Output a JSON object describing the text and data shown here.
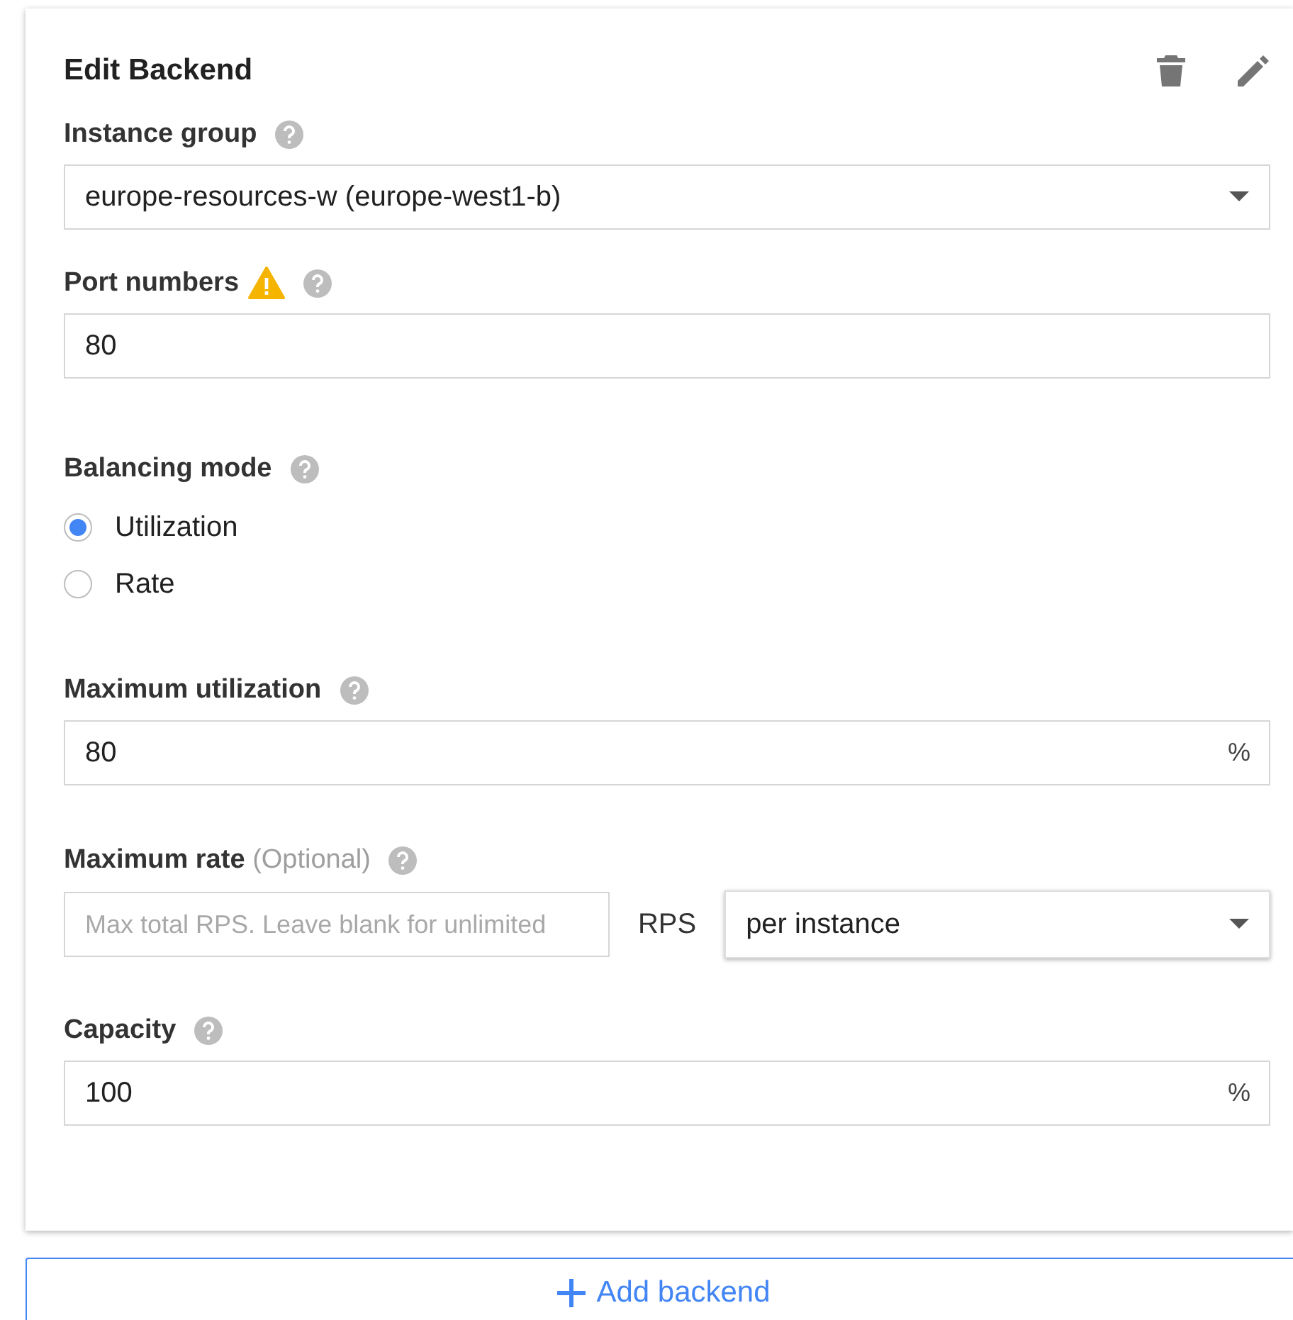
{
  "card": {
    "title": "Edit Backend"
  },
  "instance_group": {
    "label": "Instance group",
    "value": "europe-resources-w (europe-west1-b)"
  },
  "port_numbers": {
    "label": "Port numbers",
    "warning": true,
    "value": "80"
  },
  "balancing_mode": {
    "label": "Balancing mode",
    "options": [
      {
        "label": "Utilization",
        "selected": true
      },
      {
        "label": "Rate",
        "selected": false
      }
    ]
  },
  "maximum_utilization": {
    "label": "Maximum utilization",
    "value": "80",
    "suffix": "%"
  },
  "maximum_rate": {
    "label": "Maximum rate",
    "hint": "(Optional)",
    "placeholder": "Max total RPS. Leave blank for unlimited",
    "unit": "RPS",
    "scope": "per instance"
  },
  "capacity": {
    "label": "Capacity",
    "value": "100",
    "suffix": "%"
  },
  "add_button": {
    "label": "Add backend"
  }
}
